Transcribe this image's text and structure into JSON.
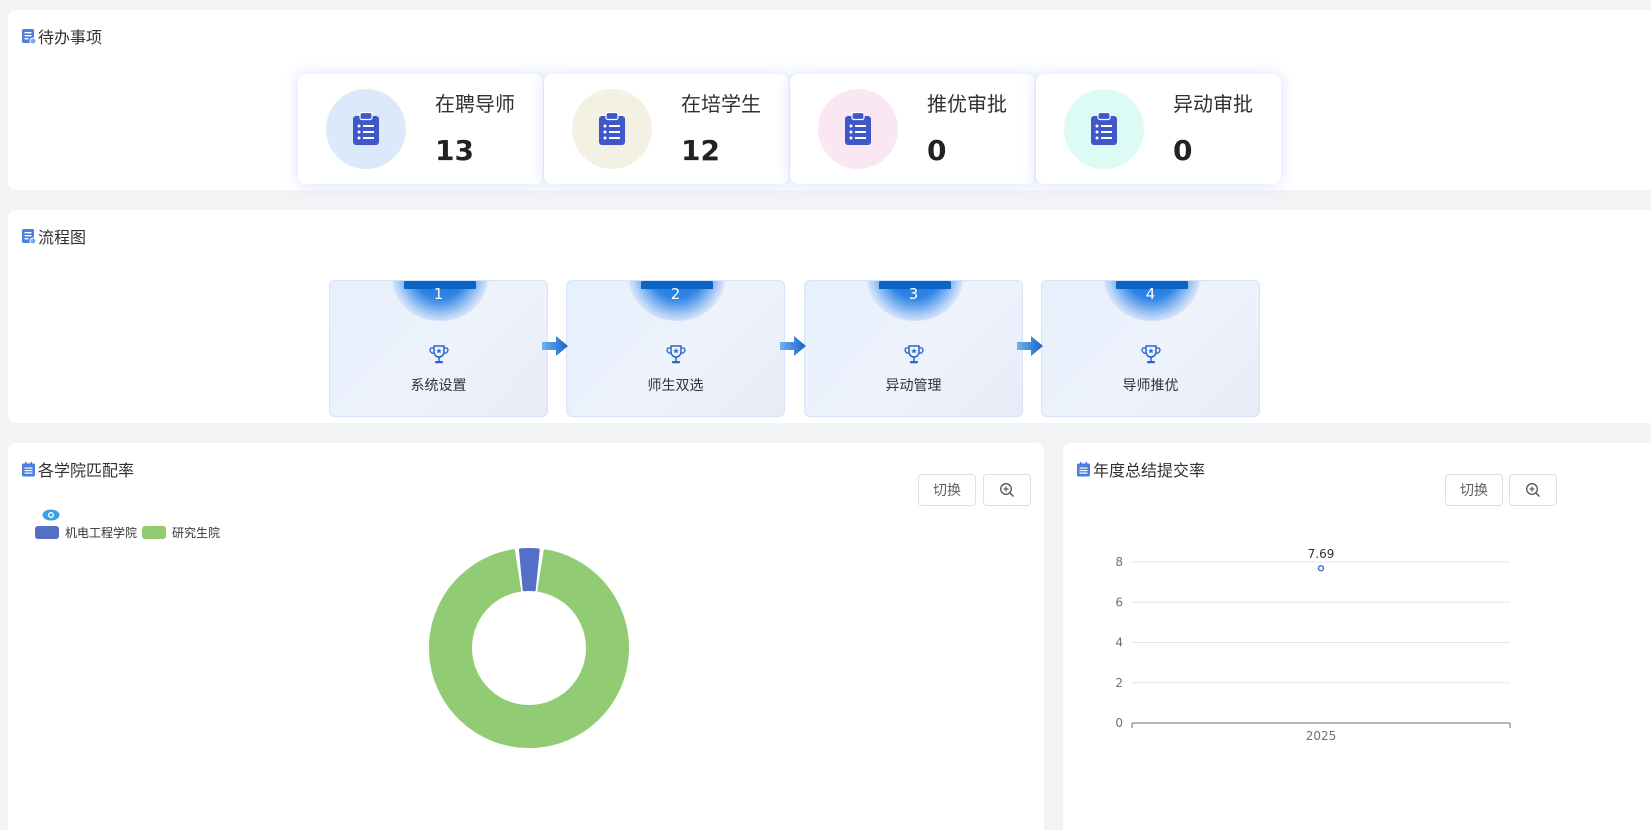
{
  "todo": {
    "title": "待办事项",
    "cards": [
      {
        "label": "在聘导师",
        "value": "13",
        "circle_color": "#dce9fb"
      },
      {
        "label": "在培学生",
        "value": "12",
        "circle_color": "#f3f1e3"
      },
      {
        "label": "推优审批",
        "value": "0",
        "circle_color": "#fbe6f4"
      },
      {
        "label": "异动审批",
        "value": "0",
        "circle_color": "#ddfbf5"
      }
    ]
  },
  "flow": {
    "title": "流程图",
    "steps": [
      {
        "num": "1",
        "label": "系统设置"
      },
      {
        "num": "2",
        "label": "师生双选"
      },
      {
        "num": "3",
        "label": "异动管理"
      },
      {
        "num": "4",
        "label": "导师推优"
      }
    ]
  },
  "match_rate": {
    "title": "各学院匹配率",
    "switch_label": "切换",
    "legend": [
      {
        "name": "机电工程学院",
        "color": "#5470c6"
      },
      {
        "name": "研究生院",
        "color": "#91cc75"
      }
    ]
  },
  "annual_rate": {
    "title": "年度总结提交率",
    "switch_label": "切换"
  },
  "chart_data": [
    {
      "type": "pie",
      "slices": [
        {
          "name": "机电工程学院",
          "value": 4,
          "color": "#5470c6"
        },
        {
          "name": "研究生院",
          "value": 96,
          "color": "#91cc75"
        }
      ],
      "donut": true,
      "legend": "top-left"
    },
    {
      "type": "scatter",
      "x": [
        "2025"
      ],
      "values": [
        7.69
      ],
      "point_labels": [
        "7.69"
      ],
      "yticks": [
        "0",
        "2",
        "4",
        "6",
        "8"
      ],
      "ylim": [
        0,
        8
      ],
      "grid": true,
      "color": "#5470c6"
    }
  ]
}
